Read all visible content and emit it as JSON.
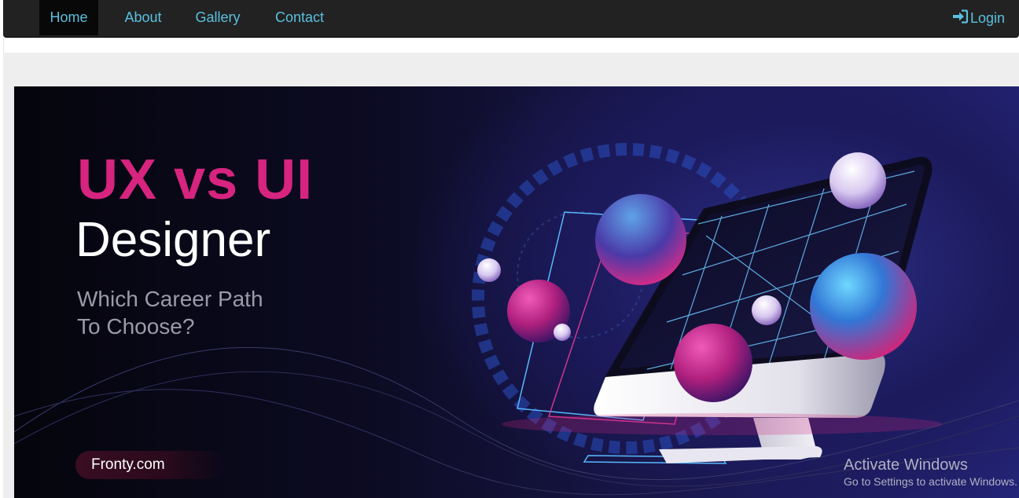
{
  "nav": {
    "items": [
      {
        "label": "Home",
        "active": true
      },
      {
        "label": "About",
        "active": false
      },
      {
        "label": "Gallery",
        "active": false
      },
      {
        "label": "Contact",
        "active": false
      }
    ],
    "login_label": "Login",
    "login_icon": "sign-in-icon"
  },
  "banner": {
    "title_line1": "UX vs UI",
    "title_line2": "Designer",
    "subtitle_line1": "Which Career Path",
    "subtitle_line2": "To Choose?",
    "brand": "Fronty.com",
    "accent_color": "#d6247f"
  },
  "watermark": {
    "title": "Activate Windows",
    "subtitle": "Go to Settings to activate Windows."
  }
}
